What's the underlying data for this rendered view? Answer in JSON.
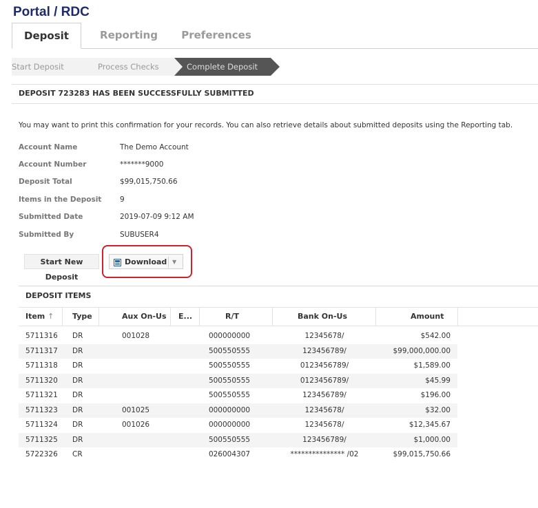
{
  "header": {
    "title": "Portal / RDC"
  },
  "tabs": [
    {
      "label": "Deposit"
    },
    {
      "label": "Reporting"
    },
    {
      "label": "Preferences"
    }
  ],
  "steps": [
    {
      "label": "Start Deposit"
    },
    {
      "label": "Process Checks"
    },
    {
      "label": "Complete Deposit"
    }
  ],
  "confirmation": {
    "title": "DEPOSIT 723283 HAS BEEN SUCCESSFULLY SUBMITTED",
    "note": "You may want to print this confirmation for your records. You can also retrieve details about submitted deposits using the Reporting tab."
  },
  "details": {
    "account_name_label": "Account Name",
    "account_name": "The Demo Account",
    "account_number_label": "Account Number",
    "account_number": "*******9000",
    "deposit_total_label": "Deposit Total",
    "deposit_total": "$99,015,750.66",
    "items_label": "Items in the Deposit",
    "items": "9",
    "submitted_date_label": "Submitted Date",
    "submitted_date": "2019-07-09 9:12 AM",
    "submitted_by_label": "Submitted By",
    "submitted_by": "SUBUSER4"
  },
  "actions": {
    "start_new": "Start New Deposit",
    "download": "Download"
  },
  "items_panel": {
    "title": "DEPOSIT ITEMS",
    "columns": {
      "item": "Item",
      "type": "Type",
      "aux": "Aux On-Us",
      "e": "E...",
      "rt": "R/T",
      "bank": "Bank On-Us",
      "amount": "Amount"
    },
    "rows": [
      {
        "item": "5711316",
        "type": "DR",
        "aux": "001028",
        "rt": "000000000",
        "bank": "12345678/",
        "amount": "$542.00"
      },
      {
        "item": "5711317",
        "type": "DR",
        "aux": "",
        "rt": "500550555",
        "bank": "123456789/",
        "amount": "$99,000,000.00"
      },
      {
        "item": "5711318",
        "type": "DR",
        "aux": "",
        "rt": "500550555",
        "bank": "0123456789/",
        "amount": "$1,589.00"
      },
      {
        "item": "5711320",
        "type": "DR",
        "aux": "",
        "rt": "500550555",
        "bank": "0123456789/",
        "amount": "$45.99"
      },
      {
        "item": "5711321",
        "type": "DR",
        "aux": "",
        "rt": "500550555",
        "bank": "123456789/",
        "amount": "$196.00"
      },
      {
        "item": "5711323",
        "type": "DR",
        "aux": "001025",
        "rt": "000000000",
        "bank": "12345678/",
        "amount": "$32.00"
      },
      {
        "item": "5711324",
        "type": "DR",
        "aux": "001026",
        "rt": "000000000",
        "bank": "12345678/",
        "amount": "$12,345.67"
      },
      {
        "item": "5711325",
        "type": "DR",
        "aux": "",
        "rt": "500550555",
        "bank": "123456789/",
        "amount": "$1,000.00"
      },
      {
        "item": "5722326",
        "type": "CR",
        "aux": "",
        "rt": "026004307",
        "bank": "*************** /02",
        "amount": "$99,015,750.66"
      }
    ]
  },
  "icons": {
    "sort": "sort-up-arrow-icon",
    "download": "save-document-icon",
    "dropdown": "chevron-down-icon"
  },
  "colors": {
    "title": "#1d2a6b",
    "highlight": "#d0202c",
    "active_step": "#555555"
  }
}
